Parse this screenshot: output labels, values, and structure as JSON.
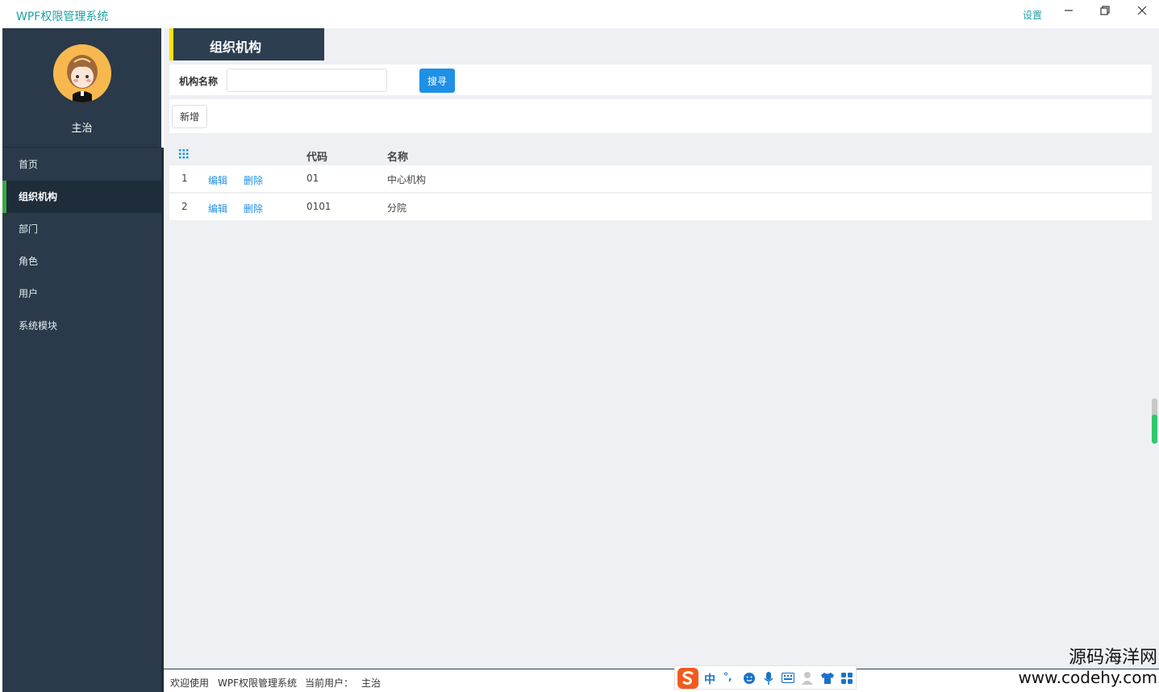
{
  "window": {
    "title": "WPF权限管理系统",
    "settings_label": "设置",
    "minimize_icon": "minimize-icon",
    "maximize_icon": "restore-icon",
    "close_icon": "close-icon"
  },
  "sidebar": {
    "user_name": "主治",
    "items": [
      {
        "label": "首页",
        "active": false
      },
      {
        "label": "组织机构",
        "active": true
      },
      {
        "label": "部门",
        "active": false
      },
      {
        "label": "角色",
        "active": false
      },
      {
        "label": "用户",
        "active": false
      },
      {
        "label": "系统模块",
        "active": false
      }
    ]
  },
  "page": {
    "title": "组织机构",
    "accent_color": "#ffe100"
  },
  "search": {
    "label": "机构名称",
    "value": "",
    "placeholder": "",
    "button_label": "搜寻"
  },
  "toolbar": {
    "add_label": "新增"
  },
  "table": {
    "columns": {
      "code": "代码",
      "name": "名称"
    },
    "rows": [
      {
        "index": "1",
        "edit": "编辑",
        "delete": "删除",
        "code": "01",
        "name": "中心机构"
      },
      {
        "index": "2",
        "edit": "编辑",
        "delete": "删除",
        "code": "0101",
        "name": "分院"
      }
    ]
  },
  "status": {
    "welcome": "欢迎使用",
    "app_name": "WPF权限管理系统",
    "current_user_label": "当前用户：",
    "current_user": "主治"
  },
  "ime": {
    "mode": "中",
    "punct": "°,"
  },
  "watermark": {
    "line1": "源码海洋网",
    "line2": "www.codehy.com"
  }
}
